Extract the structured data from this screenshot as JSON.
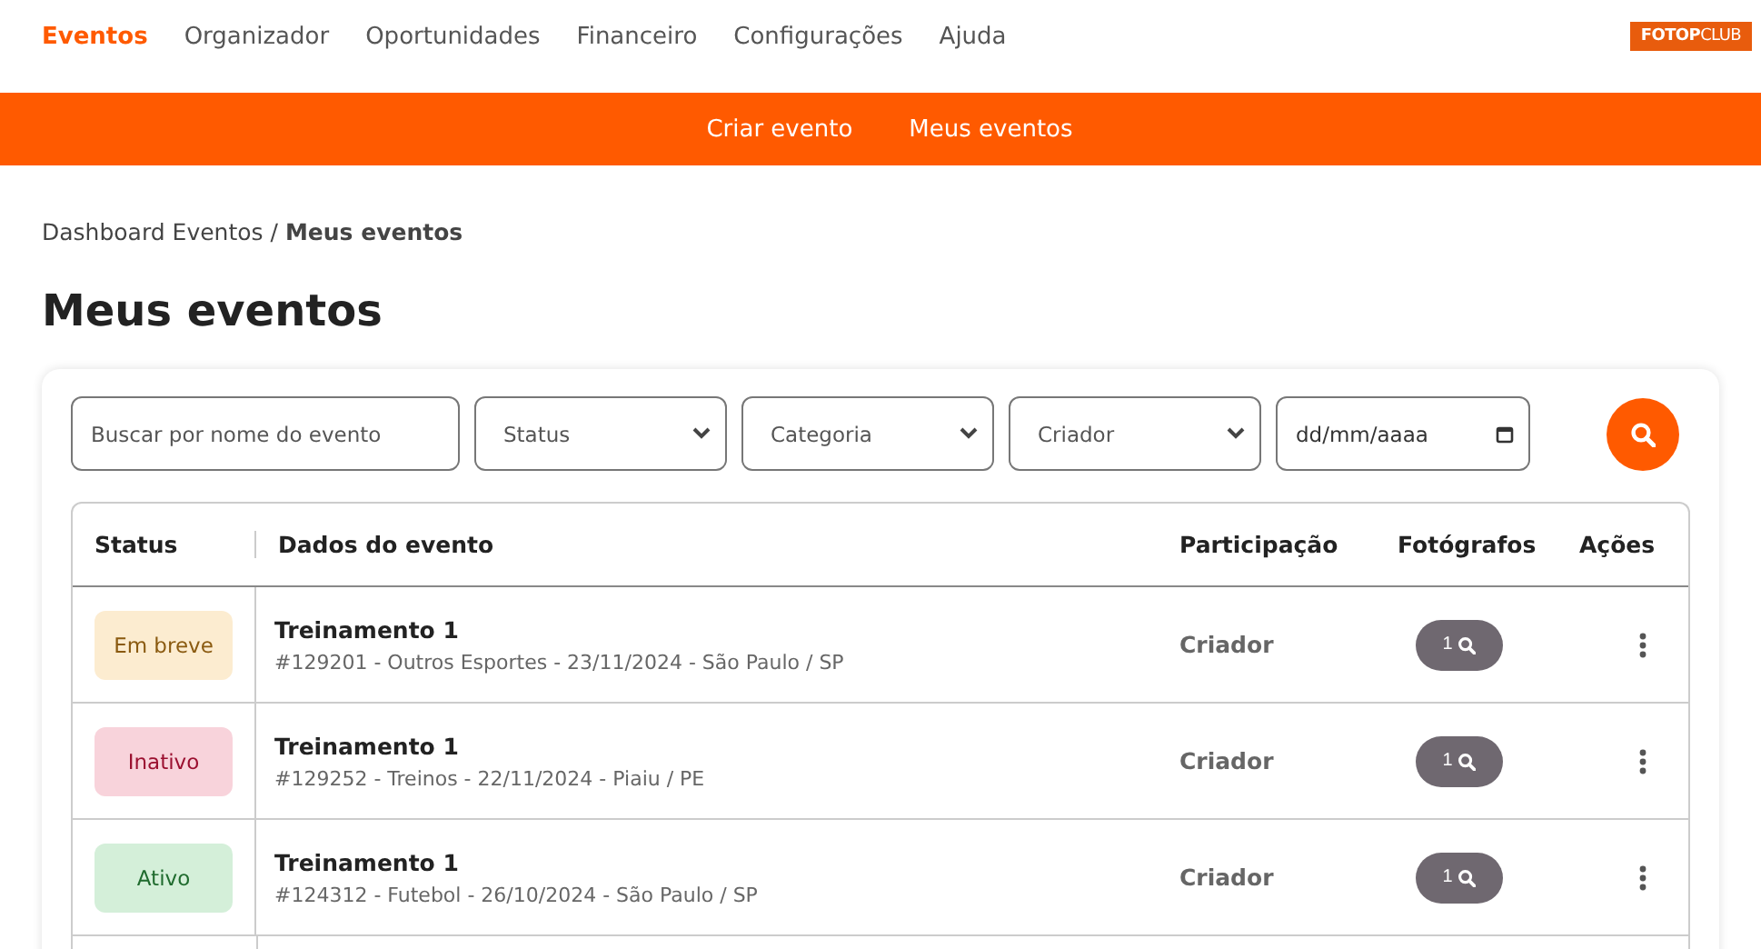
{
  "top_nav": {
    "items": [
      {
        "label": "Eventos",
        "selected": true
      },
      {
        "label": "Organizador",
        "selected": false
      },
      {
        "label": "Oportunidades",
        "selected": false
      },
      {
        "label": "Financeiro",
        "selected": false
      },
      {
        "label": "Configurações",
        "selected": false
      },
      {
        "label": "Ajuda",
        "selected": false
      }
    ],
    "logo": "**FOTOP**CLUB"
  },
  "sub_nav": {
    "items": [
      "Criar evento",
      "Meus eventos"
    ]
  },
  "breadcrumb": {
    "parent": "Dashboard Eventos",
    "separator": "/",
    "current": "Meus eventos"
  },
  "page_title": "Meus eventos",
  "filters": {
    "search": {
      "placeholder": "Buscar por nome do evento"
    },
    "selects": [
      "Status",
      "Categoria",
      "Criador"
    ],
    "date": {
      "value": "dd/mm/aaaa"
    }
  },
  "table": {
    "columns": [
      "Status",
      "Dados do evento",
      "Participação",
      "Fotógrafos",
      "Ações"
    ],
    "rows": [
      {
        "status": {
          "label": "Em breve",
          "kind": "soon"
        },
        "name": "Treinamento 1",
        "details": "#129201 - Outros Esportes - 23/11/2024 - São Paulo / SP",
        "participation": "Criador",
        "photographers": "1"
      },
      {
        "status": {
          "label": "Inativo",
          "kind": "inactive"
        },
        "name": "Treinamento 1",
        "details": "#129252 - Treinos - 22/11/2024 - Piaiu / PE",
        "participation": "Criador",
        "photographers": "1"
      },
      {
        "status": {
          "label": "Ativo",
          "kind": "active"
        },
        "name": "Treinamento 1",
        "details": "#124312 - Futebol - 26/10/2024 - São Paulo / SP",
        "participation": "Criador",
        "photographers": "1"
      }
    ]
  }
}
